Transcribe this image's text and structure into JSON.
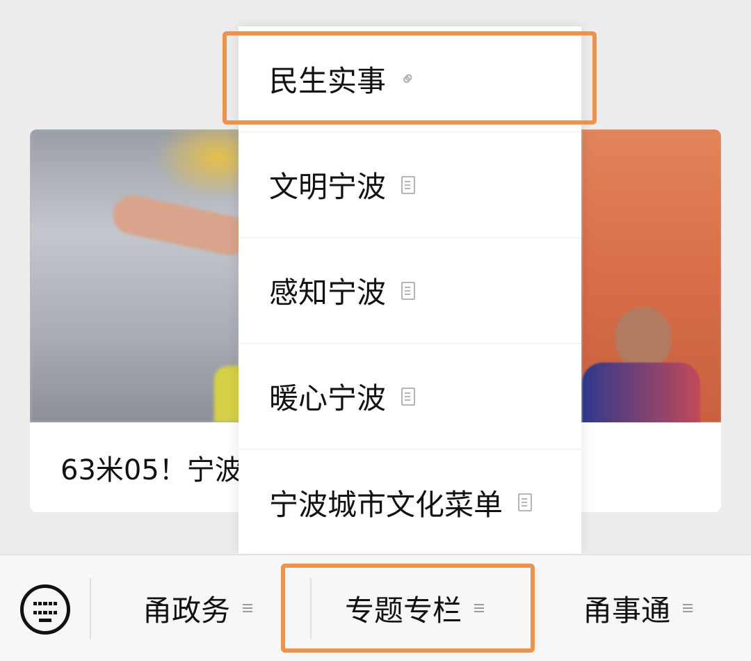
{
  "article": {
    "title": "63米05！宁波"
  },
  "popup": {
    "items": [
      {
        "label": "民生实事",
        "icon": "link-icon"
      },
      {
        "label": "文明宁波",
        "icon": "document-icon"
      },
      {
        "label": "感知宁波",
        "icon": "document-icon"
      },
      {
        "label": "暖心宁波",
        "icon": "document-icon"
      },
      {
        "label": "宁波城市文化菜单",
        "icon": "document-icon"
      }
    ]
  },
  "bottom_bar": {
    "keyboard_icon": "keyboard-icon",
    "menus": [
      {
        "label": "甬政务",
        "icon": "menu-lines-icon"
      },
      {
        "label": "专题专栏",
        "icon": "menu-lines-icon"
      },
      {
        "label": "甬事通",
        "icon": "menu-lines-icon"
      }
    ]
  },
  "colors": {
    "highlight": "#f0924a",
    "page_bg": "#ededed",
    "bar_bg": "#f7f7f7"
  }
}
